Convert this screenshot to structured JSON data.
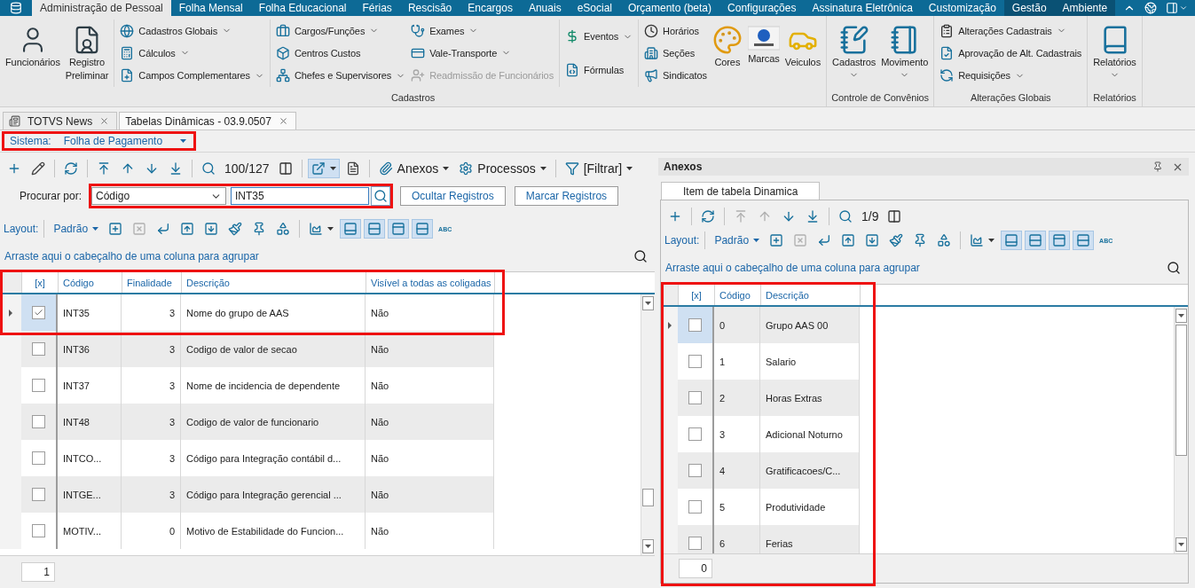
{
  "menu": {
    "tabs": [
      {
        "label": "Administração de Pessoal",
        "selected": true,
        "contextual": false
      },
      {
        "label": "Folha Mensal",
        "selected": false,
        "contextual": false
      },
      {
        "label": "Folha Educacional",
        "selected": false,
        "contextual": false
      },
      {
        "label": "Férias",
        "selected": false,
        "contextual": false
      },
      {
        "label": "Rescisão",
        "selected": false,
        "contextual": false
      },
      {
        "label": "Encargos",
        "selected": false,
        "contextual": false
      },
      {
        "label": "Anuais",
        "selected": false,
        "contextual": false
      },
      {
        "label": "eSocial",
        "selected": false,
        "contextual": false
      },
      {
        "label": "Orçamento (beta)",
        "selected": false,
        "contextual": false
      },
      {
        "label": "Configurações",
        "selected": false,
        "contextual": false
      },
      {
        "label": "Assinatura Eletrônica",
        "selected": false,
        "contextual": false
      },
      {
        "label": "Customização",
        "selected": false,
        "contextual": false
      },
      {
        "label": "Gestão",
        "selected": false,
        "contextual": true
      },
      {
        "label": "Ambiente",
        "selected": false,
        "contextual": true
      }
    ]
  },
  "ribbon": {
    "groups": [
      {
        "label": "Cadastros",
        "sections": [
          [
            {
              "kind": "large",
              "lines": [
                "Funcionários"
              ],
              "dropdown": false
            },
            {
              "kind": "large",
              "lines": [
                "Registro",
                "Preliminar"
              ],
              "dropdown": false
            }
          ],
          [
            {
              "kind": "stack",
              "items": [
                {
                  "label": "Cadastros Globais",
                  "dropdown": true,
                  "disabled": false
                },
                {
                  "label": "Cálculos",
                  "dropdown": true,
                  "disabled": false
                },
                {
                  "label": "Campos Complementares",
                  "dropdown": true,
                  "disabled": false
                }
              ]
            }
          ],
          [
            {
              "kind": "stack",
              "items": [
                {
                  "label": "Cargos/Funções",
                  "dropdown": true,
                  "disabled": false
                },
                {
                  "label": "Centros Custos",
                  "dropdown": false,
                  "disabled": false
                },
                {
                  "label": "Chefes e Supervisores",
                  "dropdown": true,
                  "disabled": false
                }
              ]
            },
            {
              "kind": "stack",
              "items": [
                {
                  "label": "Exames",
                  "dropdown": true,
                  "disabled": false
                },
                {
                  "label": "Vale-Transporte",
                  "dropdown": true,
                  "disabled": false
                },
                {
                  "label": "Readmissão de Funcionários",
                  "dropdown": false,
                  "disabled": true
                }
              ]
            }
          ],
          [
            {
              "kind": "stack",
              "items": [
                {
                  "label": "Eventos",
                  "dropdown": true,
                  "disabled": false
                },
                {
                  "label": "Fórmulas",
                  "dropdown": false,
                  "disabled": false
                }
              ]
            }
          ],
          [
            {
              "kind": "stack",
              "items": [
                {
                  "label": "Horários",
                  "dropdown": false,
                  "disabled": false
                },
                {
                  "label": "Seções",
                  "dropdown": false,
                  "disabled": false
                },
                {
                  "label": "Sindicatos",
                  "dropdown": false,
                  "disabled": false
                }
              ]
            },
            {
              "kind": "large",
              "lines": [
                "Cores"
              ],
              "dropdown": false
            },
            {
              "kind": "large",
              "lines": [
                "Marcas"
              ],
              "dropdown": false
            },
            {
              "kind": "large",
              "lines": [
                "Veiculos"
              ],
              "dropdown": false
            }
          ]
        ]
      },
      {
        "label": "Controle de Convênios",
        "sections": [
          [
            {
              "kind": "large",
              "lines": [
                "Cadastros"
              ],
              "dropdown": true
            },
            {
              "kind": "large",
              "lines": [
                "Movimento"
              ],
              "dropdown": true
            }
          ]
        ]
      },
      {
        "label": "Alterações Globais",
        "sections": [
          [
            {
              "kind": "stack",
              "items": [
                {
                  "label": "Alterações Cadastrais",
                  "dropdown": true,
                  "disabled": false
                },
                {
                  "label": "Aprovação de Alt. Cadastrais",
                  "dropdown": false,
                  "disabled": false
                },
                {
                  "label": "Requisições",
                  "dropdown": true,
                  "disabled": false
                }
              ]
            }
          ]
        ]
      },
      {
        "label": "Relatórios",
        "sections": [
          [
            {
              "kind": "large",
              "lines": [
                "Relatórios"
              ],
              "dropdown": true
            }
          ]
        ]
      }
    ]
  },
  "doc_tabs": [
    {
      "label": "TOTVS News",
      "selected": false
    },
    {
      "label": "Tabelas Dinâmicas - 03.9.0507",
      "selected": true
    }
  ],
  "system": {
    "label": "Sistema:",
    "value": "Folha de Pagamento",
    "highlighted": true
  },
  "main": {
    "toolbar": [
      {
        "kind": "icon",
        "disabled": false,
        "pressed": false,
        "dropdown": false
      },
      {
        "kind": "icon",
        "disabled": false,
        "pressed": false,
        "dropdown": false
      },
      {
        "kind": "separator"
      },
      {
        "kind": "icon",
        "disabled": false,
        "pressed": false,
        "dropdown": false
      },
      {
        "kind": "separator"
      },
      {
        "kind": "icon",
        "disabled": false,
        "pressed": false,
        "dropdown": false
      },
      {
        "kind": "icon",
        "disabled": false,
        "pressed": false,
        "dropdown": false
      },
      {
        "kind": "icon",
        "disabled": false,
        "pressed": false,
        "dropdown": false
      },
      {
        "kind": "icon",
        "disabled": false,
        "pressed": false,
        "dropdown": false
      },
      {
        "kind": "separator"
      },
      {
        "kind": "icon",
        "disabled": false,
        "pressed": false,
        "dropdown": false
      },
      {
        "kind": "text",
        "label": "100/127"
      },
      {
        "kind": "icon",
        "disabled": false,
        "pressed": false,
        "dropdown": false
      },
      {
        "kind": "separator"
      },
      {
        "kind": "icon",
        "disabled": false,
        "pressed": true,
        "dropdown": true
      },
      {
        "kind": "icon",
        "disabled": false,
        "pressed": false,
        "dropdown": false
      },
      {
        "kind": "separator"
      },
      {
        "kind": "menu",
        "label": "Anexos"
      },
      {
        "kind": "menu",
        "label": "Processos"
      },
      {
        "kind": "separator"
      },
      {
        "kind": "menu",
        "label": "[Filtrar]"
      }
    ],
    "search": {
      "label": "Procurar por:",
      "field": "Código",
      "value": "INT35",
      "highlighted": true,
      "buttons": [
        "Ocultar Registros",
        "Marcar Registros"
      ]
    },
    "layout_bar": [
      {
        "kind": "label",
        "label": "Layout:"
      },
      {
        "kind": "separator"
      },
      {
        "kind": "dropdown",
        "label": "Padrão"
      },
      {
        "kind": "icon",
        "disabled": false,
        "pressed": false,
        "dropdown": false
      },
      {
        "kind": "icon",
        "disabled": true,
        "pressed": false,
        "dropdown": false
      },
      {
        "kind": "icon",
        "disabled": false,
        "pressed": false,
        "dropdown": false
      },
      {
        "kind": "icon",
        "disabled": false,
        "pressed": false,
        "dropdown": false
      },
      {
        "kind": "icon",
        "disabled": false,
        "pressed": false,
        "dropdown": false
      },
      {
        "kind": "icon",
        "disabled": false,
        "pressed": false,
        "dropdown": false
      },
      {
        "kind": "icon",
        "disabled": false,
        "pressed": false,
        "dropdown": false
      },
      {
        "kind": "icon",
        "disabled": false,
        "pressed": false,
        "dropdown": false
      },
      {
        "kind": "separator"
      },
      {
        "kind": "icon",
        "disabled": false,
        "pressed": false,
        "dropdown": true
      },
      {
        "kind": "icon",
        "disabled": false,
        "pressed": true,
        "dropdown": false
      },
      {
        "kind": "icon",
        "disabled": false,
        "pressed": true,
        "dropdown": false
      },
      {
        "kind": "icon",
        "disabled": false,
        "pressed": true,
        "dropdown": false
      },
      {
        "kind": "icon",
        "disabled": false,
        "pressed": true,
        "dropdown": false
      },
      {
        "kind": "tag",
        "label": "ABC"
      }
    ],
    "group_hint": "Arraste aqui o cabeçalho de uma coluna para agrupar",
    "grid": {
      "highlighted": true,
      "check_header": "[x]",
      "columns": [
        "Código",
        "Finalidade",
        "Descrição",
        "Visível a todas as coligadas"
      ],
      "rows": [
        {
          "cells": [
            "INT35",
            "3",
            "Nome do grupo de AAS",
            "Não"
          ],
          "checked": true,
          "selected": true,
          "shaded": false
        },
        {
          "cells": [
            "INT36",
            "3",
            "Codigo de valor de secao",
            "Não"
          ],
          "checked": false,
          "selected": false,
          "shaded": true
        },
        {
          "cells": [
            "INT37",
            "3",
            "Nome de incidencia de dependente",
            "Não"
          ],
          "checked": false,
          "selected": false,
          "shaded": false
        },
        {
          "cells": [
            "INT48",
            "3",
            "Codigo de valor de funcionario",
            "Não"
          ],
          "checked": false,
          "selected": false,
          "shaded": true
        },
        {
          "cells": [
            "INTCO...",
            "3",
            "Código para Integração contábil d...",
            "Não"
          ],
          "checked": false,
          "selected": false,
          "shaded": false
        },
        {
          "cells": [
            "INTGE...",
            "3",
            "Código para Integração gerencial ...",
            "Não"
          ],
          "checked": false,
          "selected": false,
          "shaded": true
        },
        {
          "cells": [
            "MOTIV...",
            "0",
            "Motivo de Estabilidade do Funcion...",
            "Não"
          ],
          "checked": false,
          "selected": false,
          "shaded": false
        }
      ]
    },
    "footer_count": "1"
  },
  "panel": {
    "title": "Anexos",
    "tab": "Item de tabela Dinamica",
    "toolbar": [
      {
        "kind": "icon",
        "disabled": false,
        "pressed": false,
        "dropdown": false
      },
      {
        "kind": "separator"
      },
      {
        "kind": "icon",
        "disabled": false,
        "pressed": false,
        "dropdown": false
      },
      {
        "kind": "separator"
      },
      {
        "kind": "icon",
        "disabled": true,
        "pressed": false,
        "dropdown": false
      },
      {
        "kind": "icon",
        "disabled": true,
        "pressed": false,
        "dropdown": false
      },
      {
        "kind": "icon",
        "disabled": false,
        "pressed": false,
        "dropdown": false
      },
      {
        "kind": "icon",
        "disabled": false,
        "pressed": false,
        "dropdown": false
      },
      {
        "kind": "separator"
      },
      {
        "kind": "icon",
        "disabled": false,
        "pressed": false,
        "dropdown": false
      },
      {
        "kind": "text",
        "label": "1/9"
      },
      {
        "kind": "icon",
        "disabled": false,
        "pressed": false,
        "dropdown": false
      }
    ],
    "layout_bar": [
      {
        "kind": "label",
        "label": "Layout:"
      },
      {
        "kind": "separator"
      },
      {
        "kind": "dropdown",
        "label": "Padrão"
      },
      {
        "kind": "icon",
        "disabled": false,
        "pressed": false,
        "dropdown": false
      },
      {
        "kind": "icon",
        "disabled": true,
        "pressed": false,
        "dropdown": false
      },
      {
        "kind": "icon",
        "disabled": false,
        "pressed": false,
        "dropdown": false
      },
      {
        "kind": "icon",
        "disabled": false,
        "pressed": false,
        "dropdown": false
      },
      {
        "kind": "icon",
        "disabled": false,
        "pressed": false,
        "dropdown": false
      },
      {
        "kind": "icon",
        "disabled": false,
        "pressed": false,
        "dropdown": false
      },
      {
        "kind": "icon",
        "disabled": false,
        "pressed": false,
        "dropdown": false
      },
      {
        "kind": "icon",
        "disabled": false,
        "pressed": false,
        "dropdown": false
      },
      {
        "kind": "separator"
      },
      {
        "kind": "icon",
        "disabled": false,
        "pressed": false,
        "dropdown": true
      },
      {
        "kind": "icon",
        "disabled": false,
        "pressed": true,
        "dropdown": false
      },
      {
        "kind": "icon",
        "disabled": false,
        "pressed": true,
        "dropdown": false
      },
      {
        "kind": "icon",
        "disabled": false,
        "pressed": true,
        "dropdown": false
      },
      {
        "kind": "icon",
        "disabled": false,
        "pressed": true,
        "dropdown": false
      },
      {
        "kind": "tag",
        "label": "ABC"
      }
    ],
    "group_hint": "Arraste aqui o cabeçalho de uma coluna para agrupar",
    "grid": {
      "highlighted": true,
      "check_header": "[x]",
      "columns": [
        "Código",
        "Descrição"
      ],
      "rows": [
        {
          "cells": [
            "0",
            "Grupo AAS 00"
          ],
          "checked": false,
          "selected": true,
          "shaded": true
        },
        {
          "cells": [
            "1",
            "Salario"
          ],
          "checked": false,
          "selected": false,
          "shaded": false
        },
        {
          "cells": [
            "2",
            "Horas Extras"
          ],
          "checked": false,
          "selected": false,
          "shaded": true
        },
        {
          "cells": [
            "3",
            "Adicional Noturno"
          ],
          "checked": false,
          "selected": false,
          "shaded": false
        },
        {
          "cells": [
            "4",
            "Gratificacoes/C..."
          ],
          "checked": false,
          "selected": false,
          "shaded": true
        },
        {
          "cells": [
            "5",
            "Produtividade"
          ],
          "checked": false,
          "selected": false,
          "shaded": false
        },
        {
          "cells": [
            "6",
            "Ferias"
          ],
          "checked": false,
          "selected": false,
          "shaded": true
        }
      ]
    },
    "footer_count": "0"
  }
}
